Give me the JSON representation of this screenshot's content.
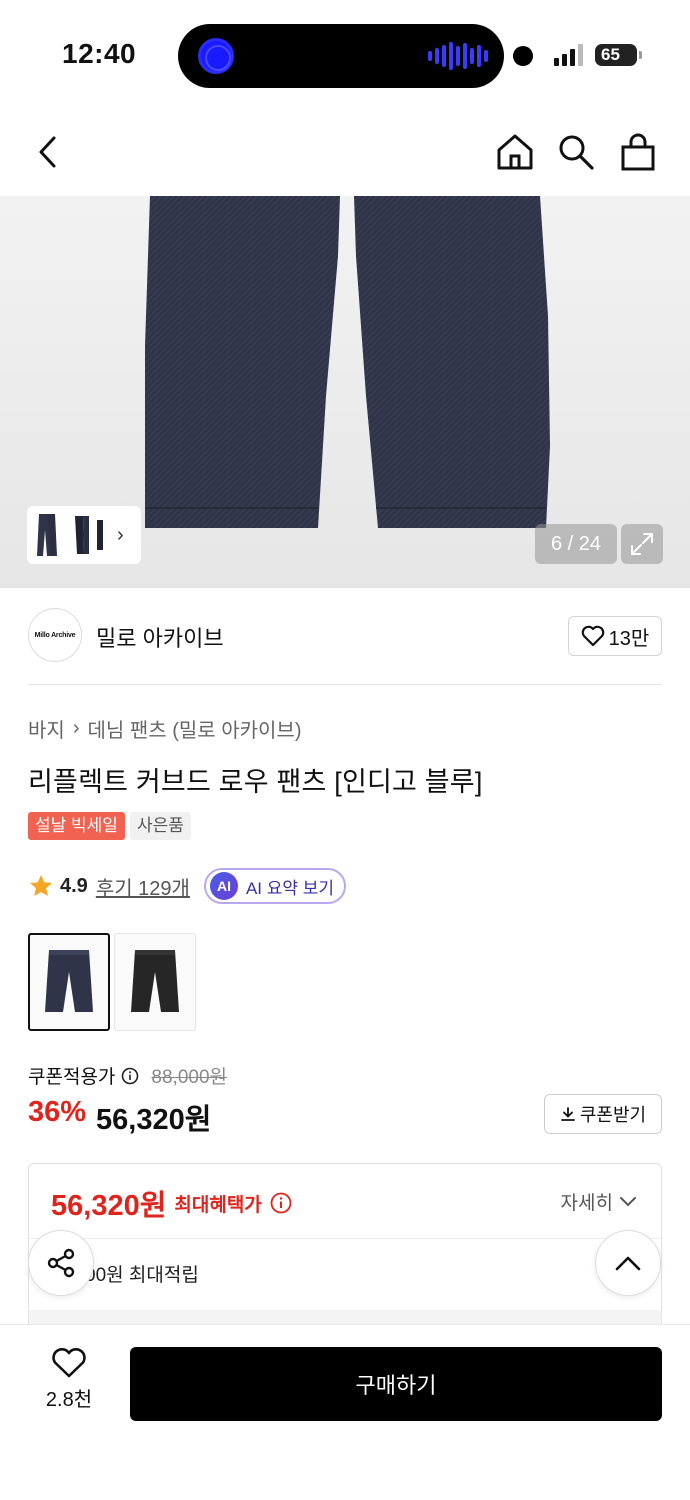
{
  "status_bar": {
    "time": "12:40",
    "battery": "65"
  },
  "nav": {
    "back_icon": "chevron-left-icon",
    "home_icon": "home-icon",
    "search_icon": "search-icon",
    "bag_icon": "shopping-bag-icon"
  },
  "gallery": {
    "counter": "6 / 24",
    "current": 6,
    "total": 24
  },
  "brand": {
    "logo_text": "Millo Archive",
    "name": "밀로 아카이브",
    "likes": "13만"
  },
  "breadcrumb": {
    "category": "바지",
    "subcategory": "데님 팬츠 (밀로 아카이브)"
  },
  "product": {
    "title": "리플렉트 커브드 로우 팬츠 [인디고 블루]",
    "badges": [
      "설날 빅세일",
      "사은품"
    ],
    "rating": "4.9",
    "reviews": "후기 129개",
    "ai_summary": "AI 요약 보기",
    "ai_badge": "AI"
  },
  "price": {
    "label": "쿠폰적용가",
    "original": "88,000원",
    "discount_rate": "36%",
    "final": "56,320원",
    "coupon_button": "쿠폰받기"
  },
  "benefit": {
    "amount": "56,320원",
    "label": "최대혜택가",
    "detail_link": "자세히",
    "points_text": "00원 최대적립"
  },
  "bottom_bar": {
    "wish_count": "2.8천",
    "buy_button": "구매하기"
  },
  "colors": {
    "accent_red": "#e0241b",
    "badge_red": "#f26250",
    "ai_purple": "#3a2fa6"
  }
}
